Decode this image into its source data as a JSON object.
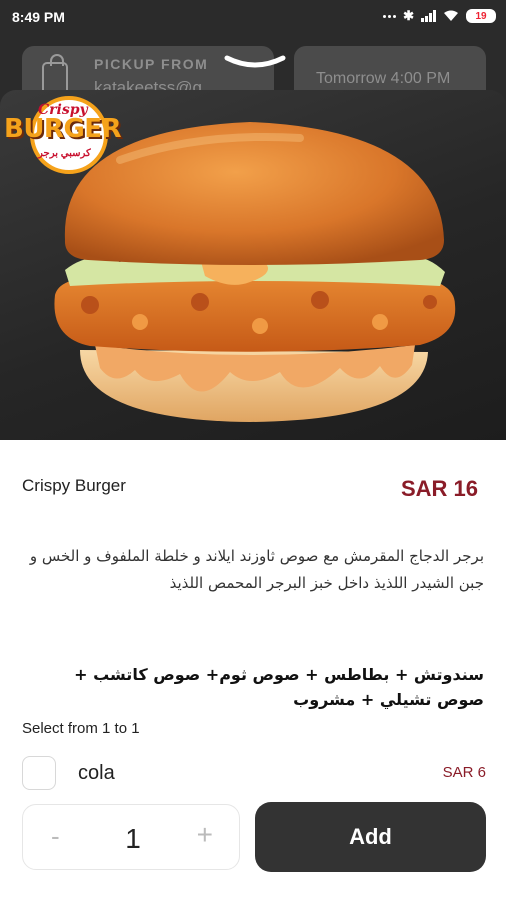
{
  "status_bar": {
    "time": "8:49 PM",
    "battery": "19"
  },
  "pickup": {
    "label": "PICKUP FROM",
    "location": "katakeetss@g"
  },
  "schedule": {
    "time": "Tomorrow 4:00 PM"
  },
  "logo": {
    "script": "Crispy",
    "word": "BURGER",
    "arabic": "كرسبي برجر"
  },
  "item": {
    "name": "Crispy Burger",
    "price": "SAR 16",
    "description": "برجر الدجاج المقرمش مع صوص ثاوزند ايلاند و خلطة الملفوف و الخس و جبن الشيدر اللذيذ داخل خبز البرجر المحمص اللذيذ"
  },
  "option_group": {
    "title": "سندوتش + بطاطس + صوص ثوم+ صوص كاتشب + صوص تشيلي + مشروب",
    "subtitle": "Select from 1 to 1",
    "options": [
      {
        "name": "cola",
        "price": "SAR 6",
        "selected": false
      }
    ]
  },
  "quantity": {
    "minus": "-",
    "value": "1",
    "plus": "+"
  },
  "add_button": {
    "label": "Add"
  },
  "colors": {
    "price_accent": "#8a1c28",
    "dark_bg": "#2b2b2b",
    "button_bg": "#333333"
  }
}
